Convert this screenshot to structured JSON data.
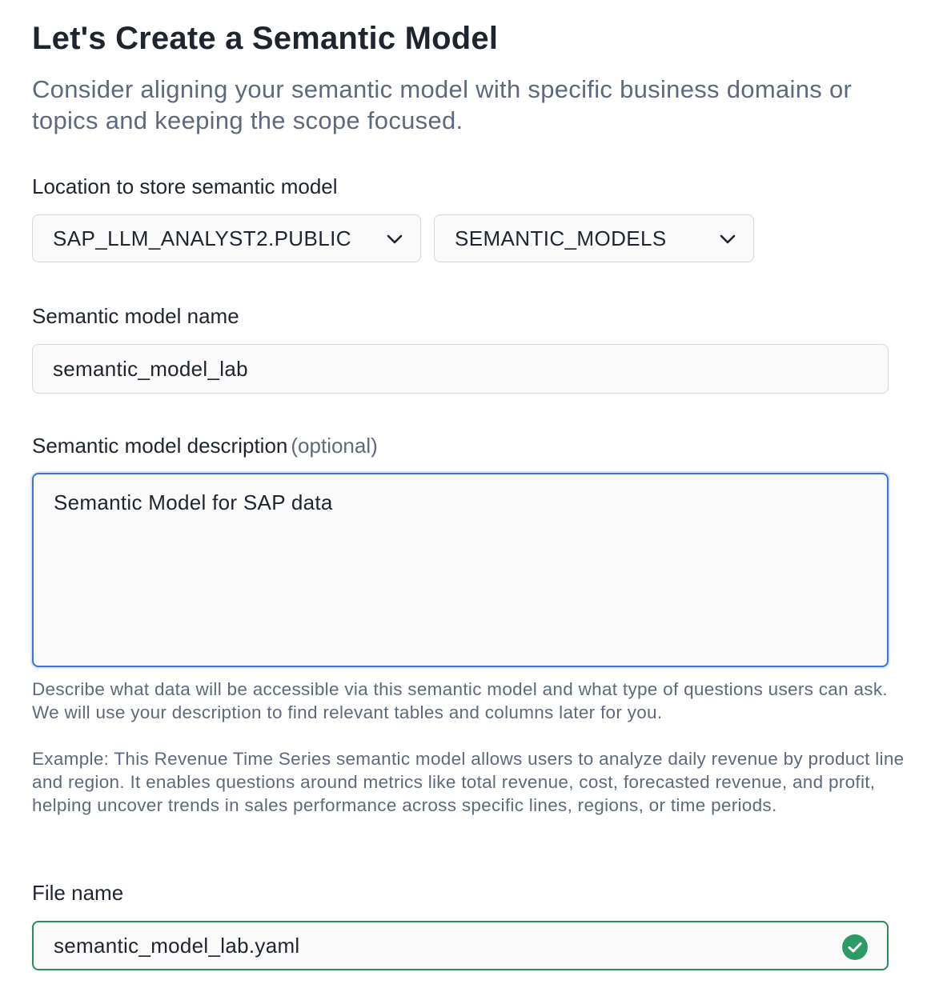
{
  "header": {
    "title": "Let's Create a Semantic Model",
    "subtitle": "Consider aligning your semantic model with specific business domains or topics and keeping the scope focused."
  },
  "location": {
    "label": "Location to store semantic model",
    "schema_select": {
      "value": "SAP_LLM_ANALYST2.PUBLIC",
      "icon": "chevron-down-icon"
    },
    "stage_select": {
      "value": "SEMANTIC_MODELS",
      "icon": "chevron-down-icon"
    }
  },
  "model_name": {
    "label": "Semantic model name",
    "value": "semantic_model_lab"
  },
  "description": {
    "label": "Semantic model description",
    "optional_label": "(optional)",
    "value": "Semantic Model for SAP data",
    "help_text": "Describe what data will be accessible via this semantic model and what type of questions users can ask. We will use your description to find relevant tables and columns later for you.",
    "example_text": "Example: This Revenue Time Series semantic model allows users to analyze daily revenue by product line and region. It enables questions around metrics like total revenue, cost, forecasted revenue, and profit, helping uncover trends in sales performance across specific lines, regions, or time periods."
  },
  "file_name": {
    "label": "File name",
    "value": "semantic_model_lab.yaml",
    "status_icon": "check-circle-icon"
  },
  "colors": {
    "focus_border": "#3f74d6",
    "valid_border": "#2e8a5c",
    "valid_icon": "#2e9a66",
    "muted_text": "#5d6a7e"
  }
}
